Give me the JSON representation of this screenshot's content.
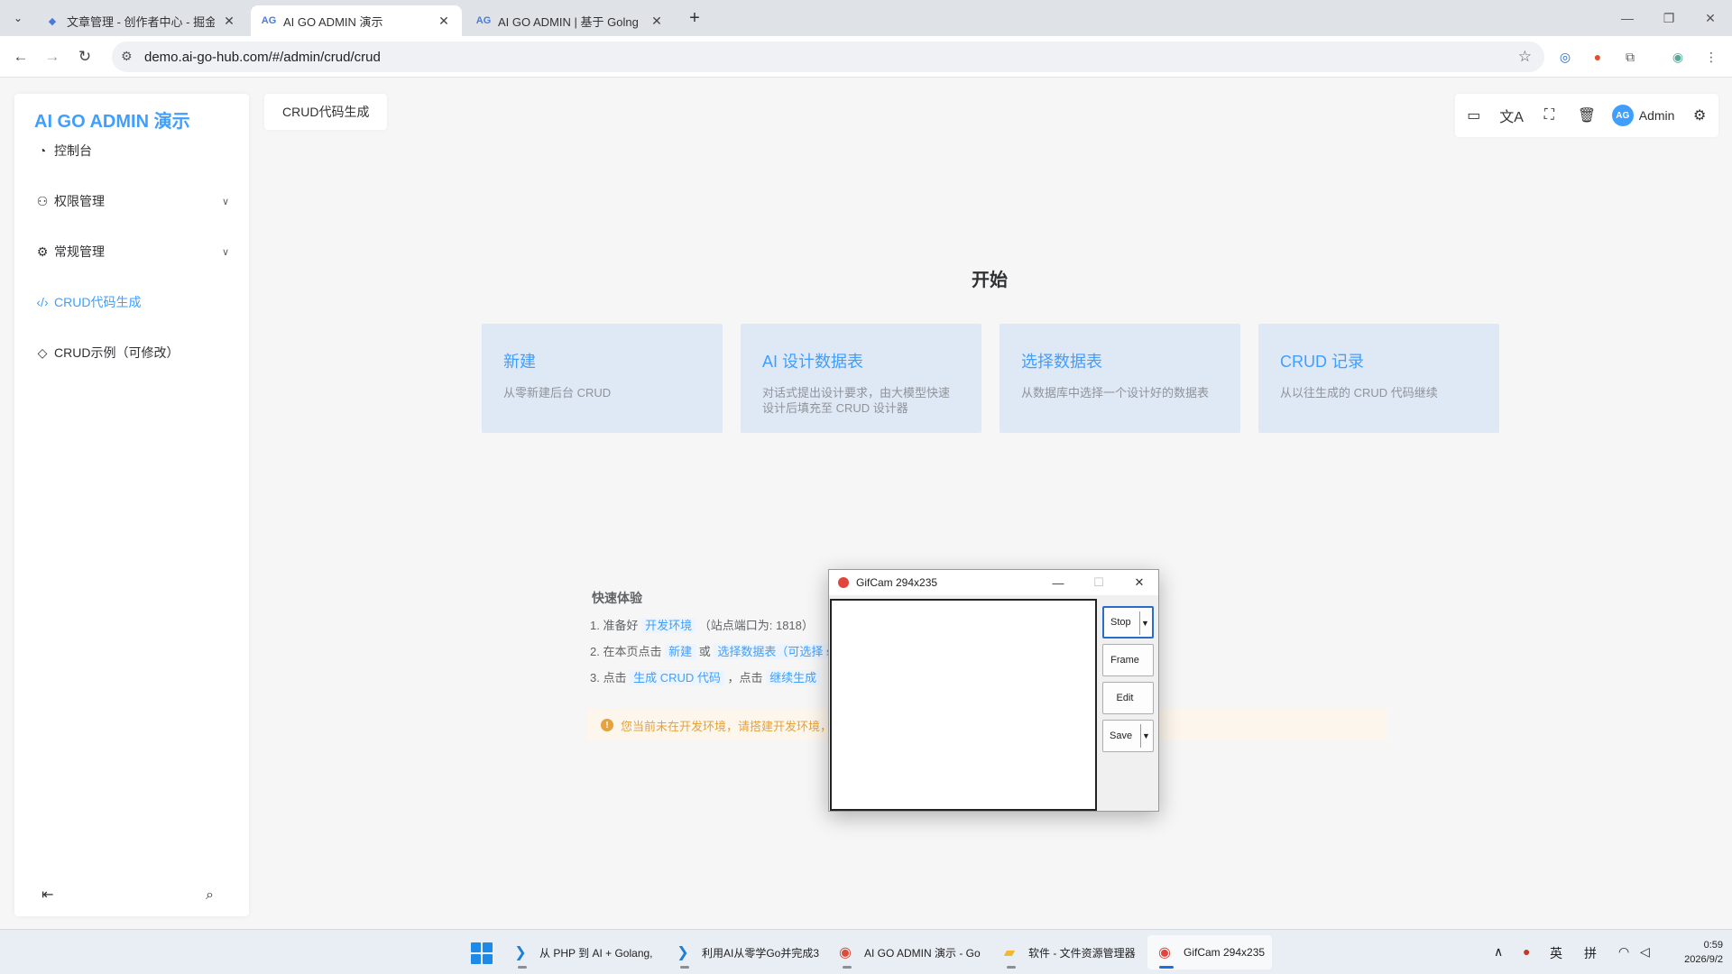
{
  "browser": {
    "tabs": [
      {
        "title": "文章管理 - 创作者中心 - 掘金",
        "favicon": "juejin-icon",
        "active": false
      },
      {
        "title": "AI GO ADMIN 演示",
        "favicon": "aigo-icon",
        "active": true
      },
      {
        "title": "AI GO ADMIN | 基于 Golng G",
        "favicon": "aigo-icon",
        "active": false
      }
    ],
    "url": "demo.ai-go-hub.com/#/admin/crud/crud"
  },
  "sidebar": {
    "logo": "AI GO ADMIN 演示",
    "items": [
      {
        "label": "控制台",
        "icon": "dashboard-icon"
      },
      {
        "label": "权限管理",
        "icon": "users-icon"
      },
      {
        "label": "常规管理",
        "icon": "gear-icon"
      },
      {
        "label": "CRUD代码生成",
        "icon": "code-icon"
      },
      {
        "label": "CRUD示例（可修改）",
        "icon": "diamond-icon"
      }
    ]
  },
  "header": {
    "breadcrumb_tab": "CRUD代码生成",
    "user_name": "Admin",
    "avatar_text": "AG"
  },
  "main": {
    "start_title": "开始",
    "cards": [
      {
        "title": "新建",
        "desc": "从零新建后台 CRUD"
      },
      {
        "title": "AI 设计数据表",
        "desc": "对话式提出设计要求，由大模型快速设计后填充至 CRUD 设计器"
      },
      {
        "title": "选择数据表",
        "desc": "从数据库中选择一个设计好的数据表"
      },
      {
        "title": "CRUD 记录",
        "desc": "从以往生成的 CRUD 代码继续"
      }
    ],
    "quick": {
      "title": "快速体验",
      "step1_prefix": "1. 准备好",
      "step1_chip": "开发环境",
      "step1_suffix": "（站点端口为: 1818）",
      "step2_prefix": "2. 在本页点击",
      "step2_chip1": "新建",
      "step2_mid": "或",
      "step2_chip2": "选择数据表（可选择 samples 数据表）",
      "step3_prefix": "3. 点击",
      "step3_chip1": "生成 CRUD 代码",
      "step3_mid": "，点击",
      "step3_chip2": "继续生成",
      "alert": "您当前未在开发环境，请搭建开发环境，或生成好代码之后重新编译"
    }
  },
  "gifcam": {
    "title": "GifCam 294x235",
    "buttons": {
      "stop": "Stop",
      "frame": "Frame",
      "edit": "Edit",
      "save": "Save"
    }
  },
  "taskbar": {
    "tasks": [
      {
        "label": "从 PHP 到 AI + Golang,",
        "icon": "vscode-icon"
      },
      {
        "label": "利用AI从零学Go并完成3",
        "icon": "vscode-icon"
      },
      {
        "label": "AI GO ADMIN 演示 - Go",
        "icon": "chrome-icon"
      },
      {
        "label": "软件 - 文件资源管理器",
        "icon": "folder-icon"
      },
      {
        "label": "GifCam 294x235",
        "icon": "gifcam-icon"
      }
    ],
    "ime_lang": "英",
    "ime_mode": "拼",
    "time": "0:59",
    "date": "2026/9/2"
  }
}
